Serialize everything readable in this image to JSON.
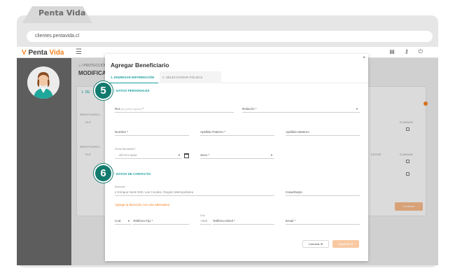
{
  "browser": {
    "tab_title": "Penta Vida",
    "url": "clientes.pentavida.cl"
  },
  "app": {
    "logo_mark": "V",
    "logo_penta": "Penta",
    "logo_vida": "Vida",
    "menu_icon": "menu-icon",
    "brand_color": "#f58220",
    "accent_color": "#1b9fa1"
  },
  "background": {
    "breadcrumb": "⌂ / PROTECCIÓN / ...",
    "page_title": "MODIFICACI...",
    "card_step": "1. DE",
    "group_1": "BENEFICIARIO...",
    "col_rut": "RUT",
    "group_2": "BENEFICIARIO...",
    "col_rut_2": "RUT",
    "col_eliminar": "ELIMINAR",
    "col_eliminar_2": "ELIMINAR",
    "col_editar": "EDITAR",
    "next_button": "Continuar"
  },
  "modal": {
    "title": "Agregar Beneficiario",
    "close": "×",
    "tabs": [
      {
        "label": "1. INGRESAR INFORMACIÓN"
      },
      {
        "label": "2. SELECCIONAR PÓLIZAS"
      }
    ],
    "section_personal": "DATOS PERSONALES",
    "section_contact": "DATOS DE CONTACTO",
    "step_personal": "5",
    "step_contact": "6",
    "fields": {
      "rut_label": "Rut",
      "rut_hint": "(sin punto ni guión)",
      "relacion": "Relación *",
      "nombre": "Nombre *",
      "apellido_paterno": "Apellido Paterno *",
      "apellido_materno": "Apellido Materno",
      "fecha_label": "Fecha Nacimiento *",
      "fecha_placeholder": "dd-mm-aaaa",
      "sexo": "Sexo *",
      "direccion_label": "Dirección",
      "direccion_value": "Enrique Norte 930, Las Condes, Región Metropolitana",
      "casa_depto": "Casa/Depto",
      "alt_address_link": "Agrega la dirección con otra alternativa",
      "cod": "Cod.",
      "telefono_fijo": "Teléfono Fijo *",
      "cod_label": "Cod.",
      "cod_value": "+569",
      "telefono_movil": "Teléfono Móvil *",
      "email": "Email *"
    },
    "buttons": {
      "cancel": "Cancelar",
      "next": "Siguiente"
    }
  }
}
